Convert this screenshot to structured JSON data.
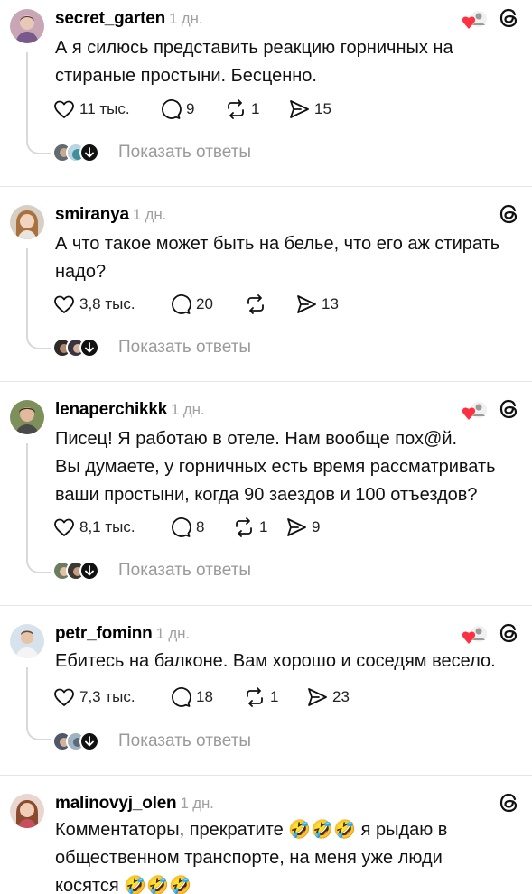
{
  "comments": [
    {
      "username": "secret_garten",
      "time": "1 дн.",
      "lines": [
        "А я силюсь представить реакцию горничных на",
        "стираные простыни. Бесценно."
      ],
      "likes": "11 тыс.",
      "replies": "9",
      "reposts": "1",
      "shares": "15",
      "show_replies": "Показать ответы",
      "author_liked": true
    },
    {
      "username": "smiranya",
      "time": "1 дн.",
      "lines": [
        "А что такое может быть на белье, что его аж стирать",
        "надо?"
      ],
      "likes": "3,8 тыс.",
      "replies": "20",
      "reposts": "",
      "shares": "13",
      "show_replies": "Показать ответы",
      "author_liked": false
    },
    {
      "username": "lenaperchikkk",
      "time": "1 дн.",
      "lines": [
        "Писец! Я работаю в отеле. Нам вообще пох@й.",
        "Вы думаете, у горничных есть время рассматривать",
        "ваши простыни, когда 90 заездов и 100 отъездов?"
      ],
      "likes": "8,1 тыс.",
      "replies": "8",
      "reposts": "1",
      "shares": "9",
      "show_replies": "Показать ответы",
      "author_liked": true
    },
    {
      "username": "petr_fominn",
      "time": "1 дн.",
      "lines": [
        "Ебитесь на балконе. Вам хорошо и соседям весело."
      ],
      "likes": "7,3 тыс.",
      "replies": "18",
      "reposts": "1",
      "shares": "23",
      "show_replies": "Показать ответы",
      "author_liked": true
    },
    {
      "username": "malinovyj_olen",
      "time": "1 дн.",
      "lines": [
        "Комментаторы, прекратите 🤣🤣🤣 я рыдаю в",
        "общественном транспорте, на меня уже люди",
        "косятся 🤣🤣🤣"
      ],
      "author_liked": false
    }
  ],
  "icons": {
    "like": "heart-outline-icon",
    "reply": "speech-bubble-icon",
    "repost": "repost-arrows-icon",
    "share": "send-icon",
    "threads": "threads-logo-icon",
    "liked_by_author": "liked-by-author-heart-icon",
    "show_replies": "arrow-down-circle-icon"
  },
  "colors": {
    "text": "#111111",
    "muted": "#a0a0a0",
    "liked_heart": "#ff3040",
    "divider": "#e6e6e6"
  }
}
